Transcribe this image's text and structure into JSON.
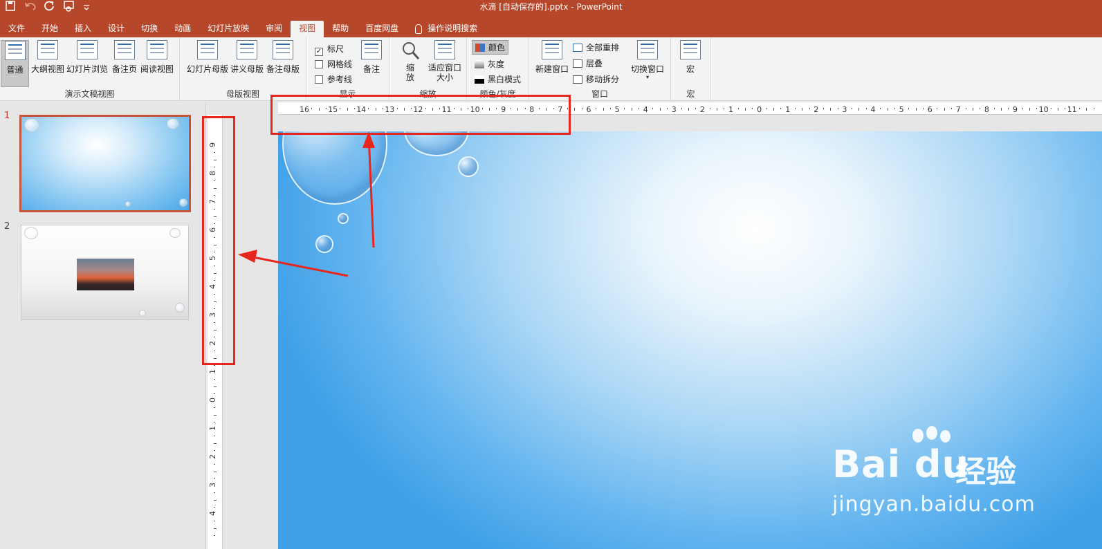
{
  "titlebar": {
    "doc_title": "水滴 [自动保存的].pptx  -  PowerPoint",
    "qat_icons": [
      "save-icon",
      "undo-icon",
      "redo-icon",
      "presentation-icon",
      "customize-icon"
    ]
  },
  "tabs": [
    "文件",
    "开始",
    "插入",
    "设计",
    "切换",
    "动画",
    "幻灯片放映",
    "审阅",
    "视图",
    "帮助",
    "百度网盘"
  ],
  "active_tab": "视图",
  "tell_me": "操作说明搜索",
  "ribbon": {
    "presentation_views": {
      "label": "演示文稿视图",
      "buttons": [
        "普通",
        "大纲视图",
        "幻灯片浏览",
        "备注页",
        "阅读视图"
      ]
    },
    "master_views": {
      "label": "母版视图",
      "buttons": [
        "幻灯片母版",
        "讲义母版",
        "备注母版"
      ]
    },
    "show": {
      "label": "显示",
      "checkboxes": [
        {
          "label": "标尺",
          "checked": true
        },
        {
          "label": "网格线",
          "checked": false
        },
        {
          "label": "参考线",
          "checked": false
        }
      ],
      "notes": "备注"
    },
    "zoom": {
      "label": "缩放",
      "zoom": "缩放",
      "fit": "适应窗口大小"
    },
    "color": {
      "label": "颜色/灰度",
      "options": [
        "颜色",
        "灰度",
        "黑白模式"
      ]
    },
    "window": {
      "label": "窗口",
      "new_window": "新建窗口",
      "arrange_all": "全部重排",
      "cascade": "层叠",
      "move_split": "移动拆分",
      "switch": "切换窗口"
    },
    "macros": {
      "label": "宏",
      "macros": "宏"
    }
  },
  "ruler": {
    "h_ticks": [
      "16",
      "15",
      "14",
      "13",
      "12",
      "11",
      "10",
      "9",
      "8",
      "7",
      "6",
      "5",
      "4",
      "3",
      "2",
      "1",
      "0",
      "1",
      "2",
      "3",
      "4",
      "5",
      "6",
      "7",
      "8",
      "9",
      "10",
      "11"
    ],
    "v_ticks": [
      "9",
      "8",
      "7",
      "6",
      "5",
      "4",
      "3",
      "2",
      "1",
      "0",
      "1",
      "2",
      "3",
      "4"
    ]
  },
  "slides": [
    {
      "num": "1"
    },
    {
      "num": "2"
    }
  ],
  "watermark": {
    "logo": "Bai du",
    "cn": "经验",
    "url": "jingyan.baidu.com"
  }
}
